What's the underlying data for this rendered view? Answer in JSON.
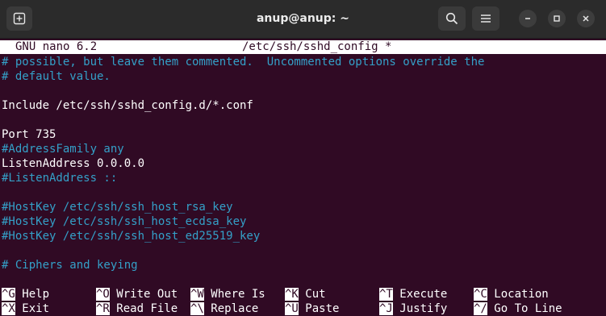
{
  "window": {
    "title": "anup@anup: ~"
  },
  "nano": {
    "version": "GNU nano 6.2",
    "filename": "/etc/ssh/sshd_config *"
  },
  "lines": [
    {
      "text": "# possible, but leave them commented.  Uncommented options override the",
      "type": "comment"
    },
    {
      "text": "# default value.",
      "type": "comment"
    },
    {
      "text": "",
      "type": "code"
    },
    {
      "text": "Include /etc/ssh/sshd_config.d/*.conf",
      "type": "code"
    },
    {
      "text": "",
      "type": "code"
    },
    {
      "text": "Port 735",
      "type": "code"
    },
    {
      "text": "#AddressFamily any",
      "type": "comment"
    },
    {
      "text": "ListenAddress 0.0.0.0",
      "type": "code"
    },
    {
      "text": "#ListenAddress ::",
      "type": "comment"
    },
    {
      "text": "",
      "type": "code"
    },
    {
      "text": "#HostKey /etc/ssh/ssh_host_rsa_key",
      "type": "comment"
    },
    {
      "text": "#HostKey /etc/ssh/ssh_host_ecdsa_key",
      "type": "comment"
    },
    {
      "text": "#HostKey /etc/ssh/ssh_host_ed25519_key",
      "type": "comment"
    },
    {
      "text": "",
      "type": "code"
    },
    {
      "text": "# Ciphers and keying",
      "type": "comment"
    }
  ],
  "shortcuts": {
    "row1": [
      {
        "key": "^G",
        "label": "Help"
      },
      {
        "key": "^O",
        "label": "Write Out"
      },
      {
        "key": "^W",
        "label": "Where Is"
      },
      {
        "key": "^K",
        "label": "Cut"
      },
      {
        "key": "^T",
        "label": "Execute"
      },
      {
        "key": "^C",
        "label": "Location"
      }
    ],
    "row2": [
      {
        "key": "^X",
        "label": "Exit"
      },
      {
        "key": "^R",
        "label": "Read File"
      },
      {
        "key": "^\\",
        "label": "Replace"
      },
      {
        "key": "^U",
        "label": "Paste"
      },
      {
        "key": "^J",
        "label": "Justify"
      },
      {
        "key": "^/",
        "label": "Go To Line"
      }
    ]
  },
  "colors": {
    "background": "#300a24",
    "comment": "#34a0c8",
    "text": "#ffffff",
    "titlebar": "#2b2b2b"
  },
  "icons": [
    "new-tab-icon",
    "search-icon",
    "hamburger-menu-icon",
    "minimize-icon",
    "maximize-icon",
    "close-icon"
  ]
}
